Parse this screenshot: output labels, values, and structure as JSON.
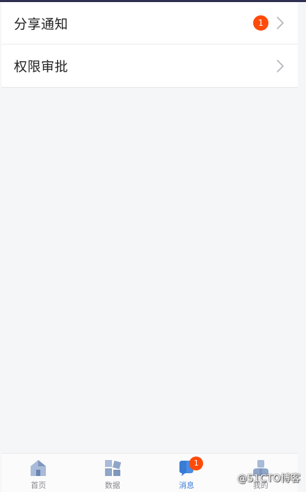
{
  "list": {
    "items": [
      {
        "label": "分享通知",
        "badge": "1"
      },
      {
        "label": "权限审批",
        "badge": ""
      }
    ]
  },
  "tabbar": {
    "tabs": [
      {
        "label": "首页",
        "icon": "home-icon",
        "active": false
      },
      {
        "label": "数据",
        "icon": "data-icon",
        "active": false
      },
      {
        "label": "消息",
        "icon": "message-icon",
        "active": true,
        "badge": "1"
      },
      {
        "label": "我的",
        "icon": "profile-icon",
        "active": false
      }
    ]
  },
  "watermark": {
    "text": "@51CTO博客"
  },
  "colors": {
    "badge": "#ff4a0a",
    "active_tab": "#3a7bd5",
    "icon_fill": "#8fa6c8"
  }
}
